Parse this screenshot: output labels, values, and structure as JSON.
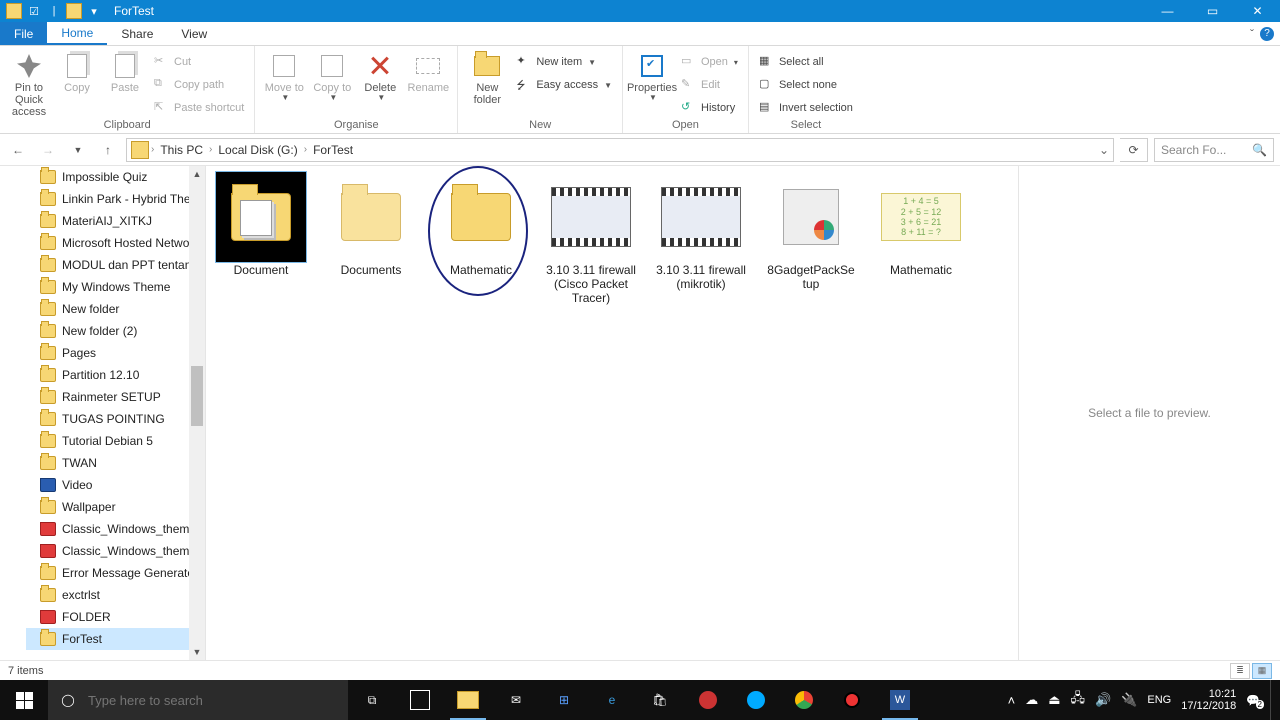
{
  "titlebar": {
    "title": "ForTest"
  },
  "tabs": {
    "file": "File",
    "home": "Home",
    "share": "Share",
    "view": "View"
  },
  "ribbon": {
    "clipboard": {
      "title": "Clipboard",
      "pin": "Pin to Quick access",
      "copy": "Copy",
      "paste": "Paste",
      "cut": "Cut",
      "copypath": "Copy path",
      "pasteshort": "Paste shortcut"
    },
    "organise": {
      "title": "Organise",
      "moveto": "Move to",
      "copyto": "Copy to",
      "delete": "Delete",
      "rename": "Rename"
    },
    "new": {
      "title": "New",
      "newfolder": "New folder",
      "newitem": "New item",
      "easyaccess": "Easy access"
    },
    "open": {
      "title": "Open",
      "properties": "Properties",
      "open": "Open",
      "edit": "Edit",
      "history": "History"
    },
    "select": {
      "title": "Select",
      "all": "Select all",
      "none": "Select none",
      "invert": "Invert selection"
    }
  },
  "breadcrumb": {
    "pc": "This PC",
    "disk": "Local Disk (G:)",
    "folder": "ForTest"
  },
  "search": {
    "placeholder": "Search Fo..."
  },
  "sidebar": {
    "items": [
      {
        "label": "Impossible Quiz",
        "type": "folder"
      },
      {
        "label": "Linkin Park - Hybrid Theo",
        "type": "folder"
      },
      {
        "label": "MateriAIJ_XITKJ",
        "type": "folder"
      },
      {
        "label": "Microsoft Hosted Netwo",
        "type": "folder"
      },
      {
        "label": "MODUL dan PPT tentang",
        "type": "folder"
      },
      {
        "label": "My Windows Theme",
        "type": "folder"
      },
      {
        "label": "New folder",
        "type": "folder"
      },
      {
        "label": "New folder (2)",
        "type": "folder"
      },
      {
        "label": "Pages",
        "type": "folder"
      },
      {
        "label": "Partition 12.10",
        "type": "folder"
      },
      {
        "label": "Rainmeter SETUP",
        "type": "folder"
      },
      {
        "label": "TUGAS POINTING",
        "type": "folder"
      },
      {
        "label": "Tutorial Debian 5",
        "type": "folder"
      },
      {
        "label": "TWAN",
        "type": "folder"
      },
      {
        "label": "Video",
        "type": "vid"
      },
      {
        "label": "Wallpaper",
        "type": "folder"
      },
      {
        "label": "Classic_Windows_themes",
        "type": "other"
      },
      {
        "label": "Classic_Windows_themes",
        "type": "other"
      },
      {
        "label": "Error Message Generator",
        "type": "folder"
      },
      {
        "label": "exctrlst",
        "type": "folder"
      },
      {
        "label": "FOLDER",
        "type": "other"
      },
      {
        "label": "ForTest",
        "type": "folder",
        "selected": true
      }
    ]
  },
  "files": [
    {
      "name": "Document",
      "kind": "folder-doc",
      "selected": true
    },
    {
      "name": "Documents",
      "kind": "folder-dim"
    },
    {
      "name": "Mathematic",
      "kind": "folder",
      "circled": true
    },
    {
      "name": "3.10 3.11 firewall (Cisco Packet Tracer)",
      "kind": "video"
    },
    {
      "name": "3.10 3.11 firewall (mikrotik)",
      "kind": "video"
    },
    {
      "name": "8GadgetPackSetup",
      "kind": "exe"
    },
    {
      "name": "Mathematic",
      "kind": "math"
    }
  ],
  "mathlines": [
    "1 + 4 = 5",
    "2 + 5 = 12",
    "3 + 6 = 21",
    "8 + 11 = ?"
  ],
  "preview": {
    "empty": "Select a file to preview."
  },
  "status": {
    "count": "7 items"
  },
  "taskbar": {
    "search": "Type here to search",
    "lang": "ENG",
    "time": "10:21",
    "date": "17/12/2018",
    "notif": "2"
  }
}
